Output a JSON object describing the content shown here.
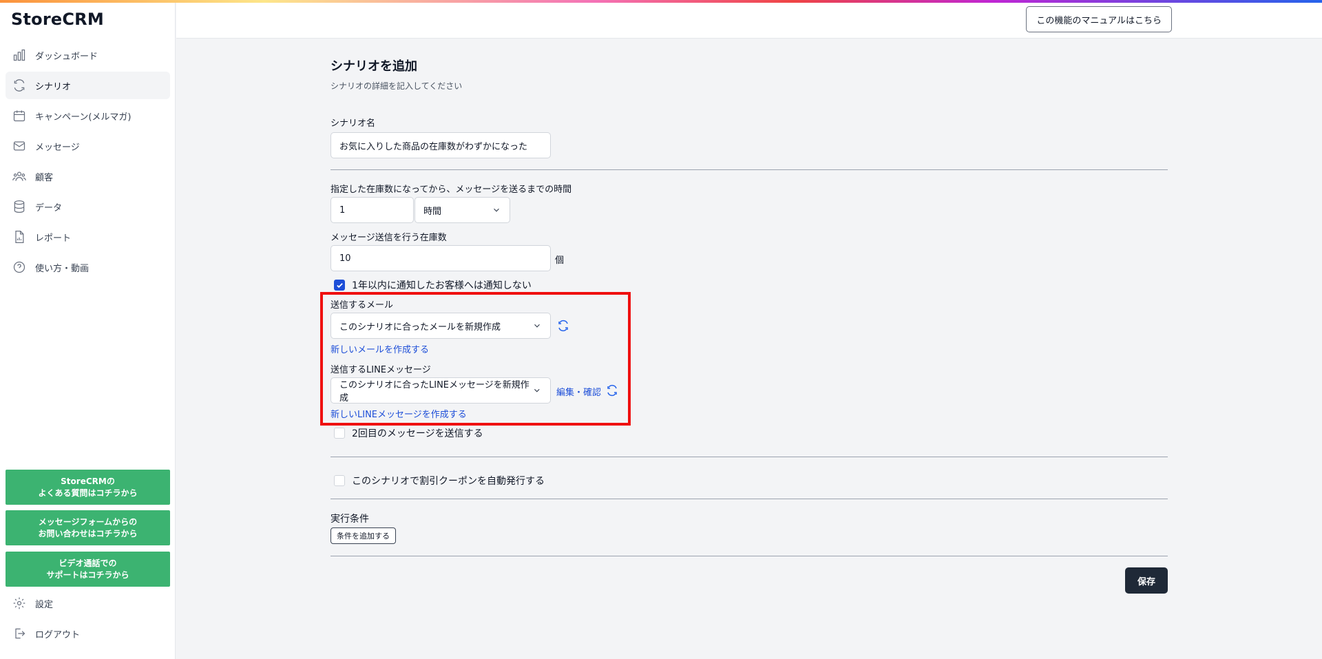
{
  "app": {
    "logo": "StoreCRM",
    "accent_color": "#1d4ed8",
    "help_color": "#3cb371"
  },
  "sidebar": {
    "items": [
      {
        "label": "ダッシュボード",
        "icon": "bar-chart-icon",
        "active": false
      },
      {
        "label": "シナリオ",
        "icon": "refresh-icon",
        "active": true
      },
      {
        "label": "キャンペーン(メルマガ)",
        "icon": "calendar-icon",
        "active": false
      },
      {
        "label": "メッセージ",
        "icon": "mail-icon",
        "active": false
      },
      {
        "label": "顧客",
        "icon": "users-icon",
        "active": false
      },
      {
        "label": "データ",
        "icon": "database-icon",
        "active": false
      },
      {
        "label": "レポート",
        "icon": "report-icon",
        "active": false
      },
      {
        "label": "使い方・動画",
        "icon": "help-icon",
        "active": false
      }
    ],
    "help_buttons": [
      "StoreCRMの\nよくある質問はコチラから",
      "メッセージフォームからの\nお問い合わせはコチラから",
      "ビデオ通話での\nサポートはコチラから"
    ],
    "settings_label": "設定",
    "logout_label": "ログアウト"
  },
  "header": {
    "manual_button": "この機能のマニュアルはこちら"
  },
  "form": {
    "title": "シナリオを追加",
    "subtitle": "シナリオの詳細を記入してください",
    "scenario_name_label": "シナリオ名",
    "scenario_name_value": "お気に入りした商品の在庫数がわずかになった",
    "wait_time_label": "指定した在庫数になってから、メッセージを送るまでの時間",
    "wait_time_value": "1",
    "wait_time_unit": "時間",
    "stock_label": "メッセージ送信を行う在庫数",
    "stock_value": "10",
    "stock_unit": "個",
    "skip_notified_label": "1年以内に通知したお客様へは通知しない",
    "skip_notified_checked": true,
    "mail_label": "送信するメール",
    "mail_selected": "このシナリオに合ったメールを新規作成",
    "new_mail_link": "新しいメールを作成する",
    "line_label": "送信するLINEメッセージ",
    "line_selected": "このシナリオに合ったLINEメッセージを新規作成",
    "line_edit_link": "編集・確認",
    "new_line_link": "新しいLINEメッセージを作成する",
    "second_message_label": "2回目のメッセージを送信する",
    "second_message_checked": false,
    "coupon_label": "このシナリオで割引クーポンを自動発行する",
    "coupon_checked": false,
    "conditions_label": "実行条件",
    "add_condition_button": "条件を追加する",
    "save_button": "保存"
  }
}
